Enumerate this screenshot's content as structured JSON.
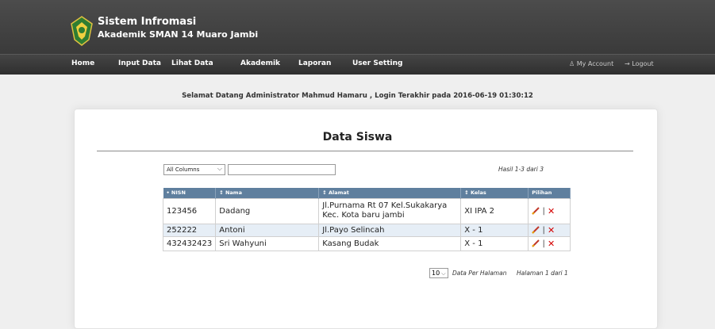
{
  "brand": {
    "line1": "Sistem Infromasi",
    "line2": "Akademik SMAN 14 Muaro Jambi"
  },
  "nav": {
    "items": [
      "Home",
      "Input Data",
      "Lihat Data",
      "Akademik",
      "Laporan",
      "User Setting"
    ],
    "my_account": "My Account",
    "logout": "Logout"
  },
  "welcome": "Selamat Datang Administrator Mahmud Hamaru , Login Terakhir pada 2016-06-19 01:30:12",
  "page_title": "Data Siswa",
  "filter": {
    "column_select": "All Columns",
    "search_value": ""
  },
  "hasil": "Hasil 1-3 dari 3",
  "table": {
    "headers": [
      "• NISN",
      "↕ Nama",
      "↕ Alamat",
      "↕ Kelas",
      "Pilihan"
    ],
    "rows": [
      {
        "nisn": "123456",
        "nama": "Dadang",
        "alamat_line1": "Jl.Purnama Rt 07 Kel.Sukakarya",
        "alamat_line2": "Kec. Kota baru jambi",
        "kelas": "XI IPA 2"
      },
      {
        "nisn": "252222",
        "nama": "Antoni",
        "alamat_line1": "Jl.Payo Selincah",
        "alamat_line2": "",
        "kelas": "X - 1"
      },
      {
        "nisn": "432432423",
        "nama": "Sri Wahyuni",
        "alamat_line1": "Kasang Budak",
        "alamat_line2": "",
        "kelas": "X - 1"
      }
    ]
  },
  "pagination": {
    "per_page": "10",
    "per_page_label": "Data Per Halaman",
    "halaman": "Halaman 1 dari 1"
  },
  "colors": {
    "header_bg": "#3a3a3a",
    "table_header": "#5f7f9e",
    "delete": "#d40000",
    "stripe": "#e6eef6"
  }
}
